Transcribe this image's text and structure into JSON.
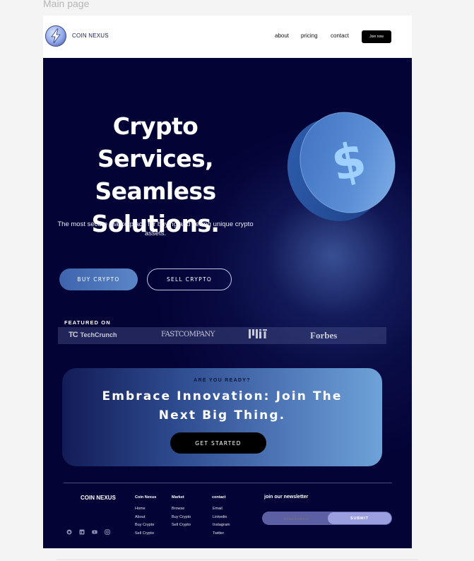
{
  "frame": {
    "label": "Main page"
  },
  "header": {
    "brand": "COIN NEXUS",
    "nav": [
      "about",
      "pricing",
      "contact"
    ],
    "join_label": "Join now"
  },
  "hero": {
    "title_lines": [
      "Crypto Services,",
      "Seamless",
      "Solutions."
    ],
    "subtitle": "The most secure marketplace for buying and selling unique crypto assets.",
    "buy_label": "BUY CRYPTO",
    "sell_label": "SELL CRYPTO"
  },
  "featured": {
    "label": "FEATURED ON",
    "logos": [
      "TechCrunch",
      "FASTCOMPANY",
      "MIT",
      "Forbes"
    ]
  },
  "cta": {
    "eyebrow": "ARE YOU READY?",
    "title_lines": [
      "Embrace Innovation: Join The",
      "Next Big Thing."
    ],
    "button_label": "GET STARTED"
  },
  "footer": {
    "brand": "COIN NEXUS",
    "columns": [
      {
        "title": "Coin Nexus",
        "items": [
          "Home",
          "About",
          "Buy Crypto",
          "Sell Crypto"
        ]
      },
      {
        "title": "Market",
        "items": [
          "Browse",
          "Buy Crypto",
          "Sell Crypto"
        ]
      },
      {
        "title": "contact",
        "items": [
          "Email",
          "Linkedin",
          "Instagram",
          "Twitter"
        ]
      }
    ],
    "social_icons": [
      "github-icon",
      "linkedin-icon",
      "youtube-icon",
      "instagram-icon"
    ],
    "newsletter": {
      "title": "join our newsletter",
      "placeholder": "Email Address",
      "submit_label": "SUBMIT"
    }
  },
  "colors": {
    "page_bg": "#030336",
    "accent": "#5b86c6",
    "cta_gradient_end": "#6ea2d8"
  }
}
